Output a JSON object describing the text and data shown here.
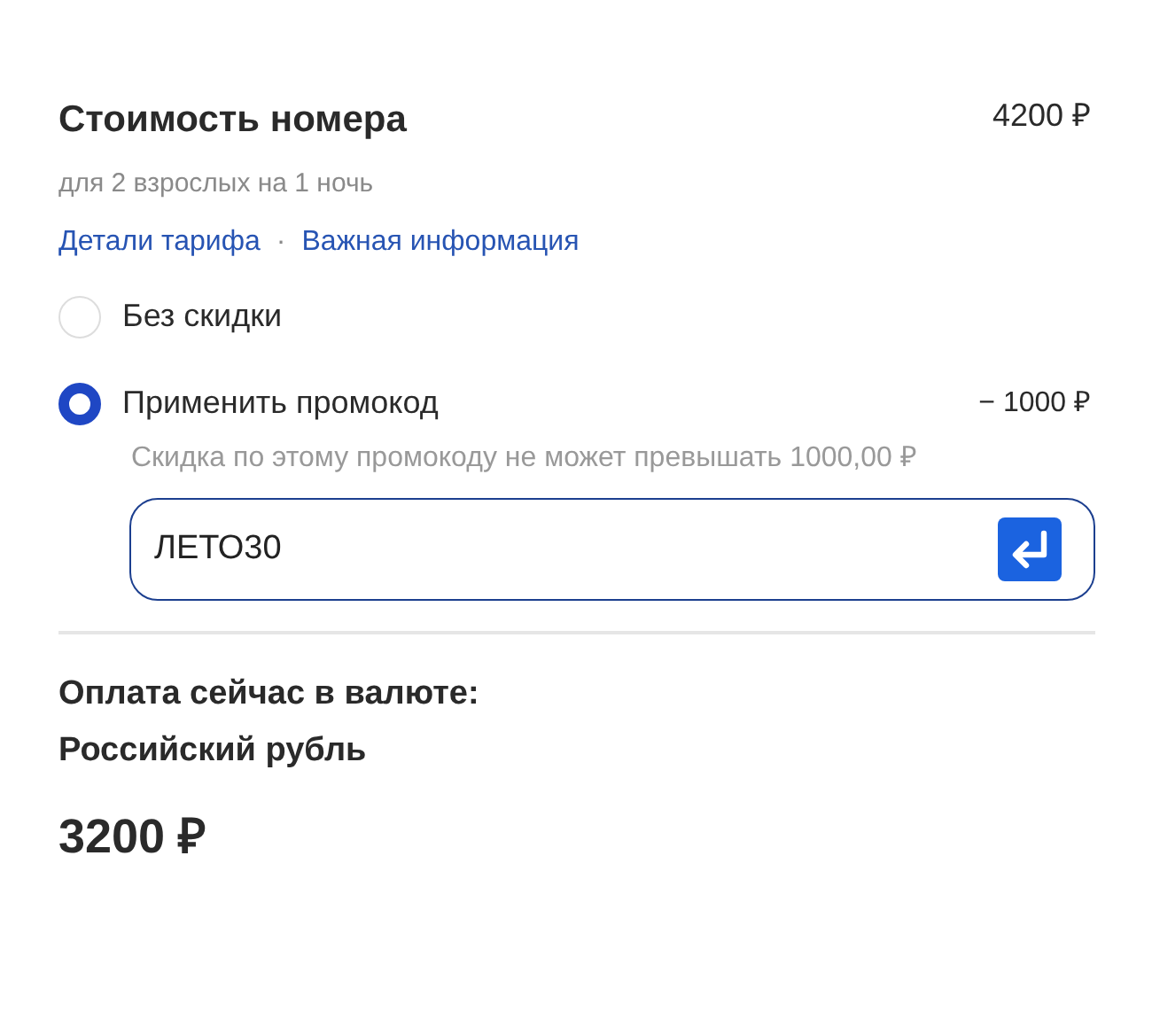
{
  "room_cost": {
    "title": "Стоимость номера",
    "price": "4200 ₽",
    "subtitle": "для 2 взрослых на 1 ночь"
  },
  "links": [
    "Детали тарифа",
    "Важная информация"
  ],
  "separator": "·",
  "options": [
    {
      "label": "Без скидки",
      "selected": false
    },
    {
      "label": "Применить промокод",
      "selected": true,
      "amount": "− 1000 ₽",
      "note": "Скидка по этому промокоду не может превышать 1000,00 ₽",
      "promo_field": {
        "value": "ЛЕТО30"
      }
    }
  ],
  "payment": {
    "label": "Оплата сейчас в валюте:",
    "currency": "Российский рубль",
    "total": "3200 ₽"
  }
}
